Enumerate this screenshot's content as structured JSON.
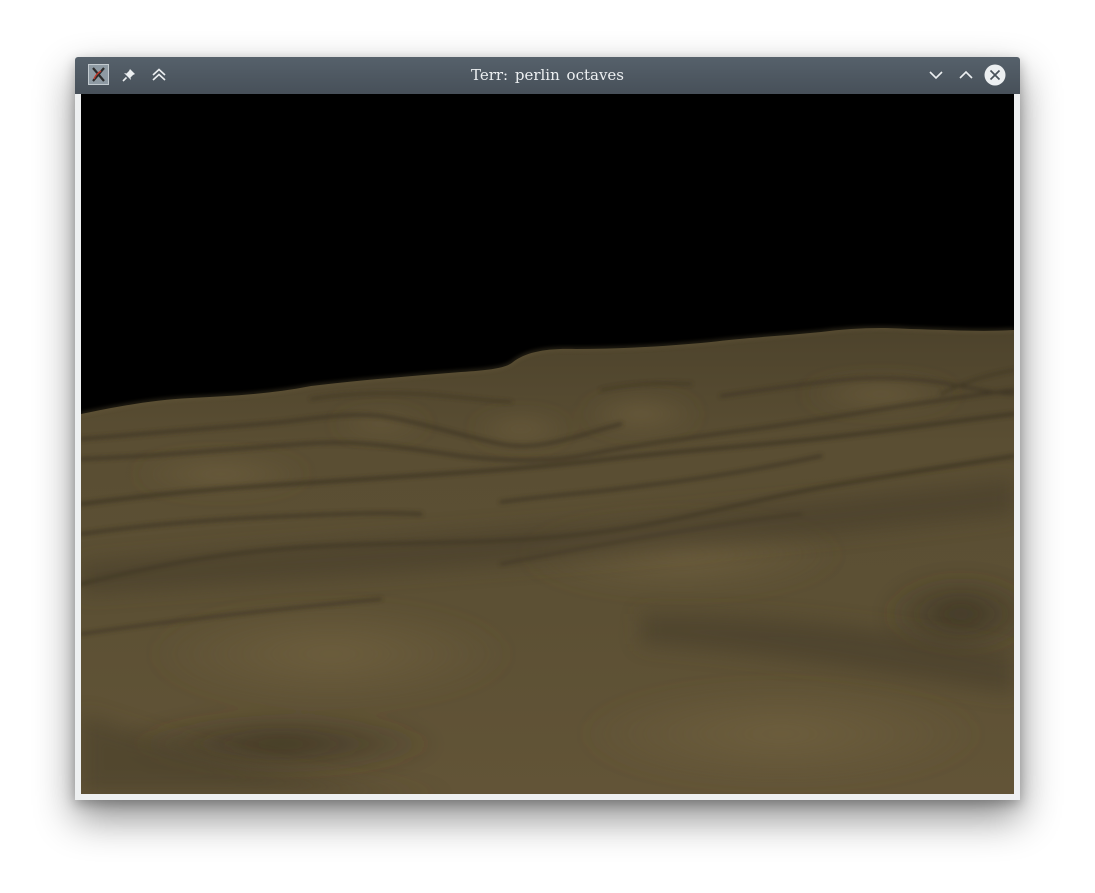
{
  "window": {
    "title": "Terr: perlin octaves"
  },
  "titlebar": {
    "app_icon": "x-app-icon",
    "pin_icon": "pin-icon",
    "keep_above_icon": "double-chevron-up-icon",
    "minimize_icon": "chevron-down-icon",
    "maximize_icon": "chevron-up-icon",
    "close_icon": "close-circle-icon"
  },
  "scene": {
    "sky_color": "#000000",
    "terrain_color": "#5e5135",
    "terrain_dark_color": "#3f3724",
    "terrain_light_color": "#6a5b3b"
  }
}
